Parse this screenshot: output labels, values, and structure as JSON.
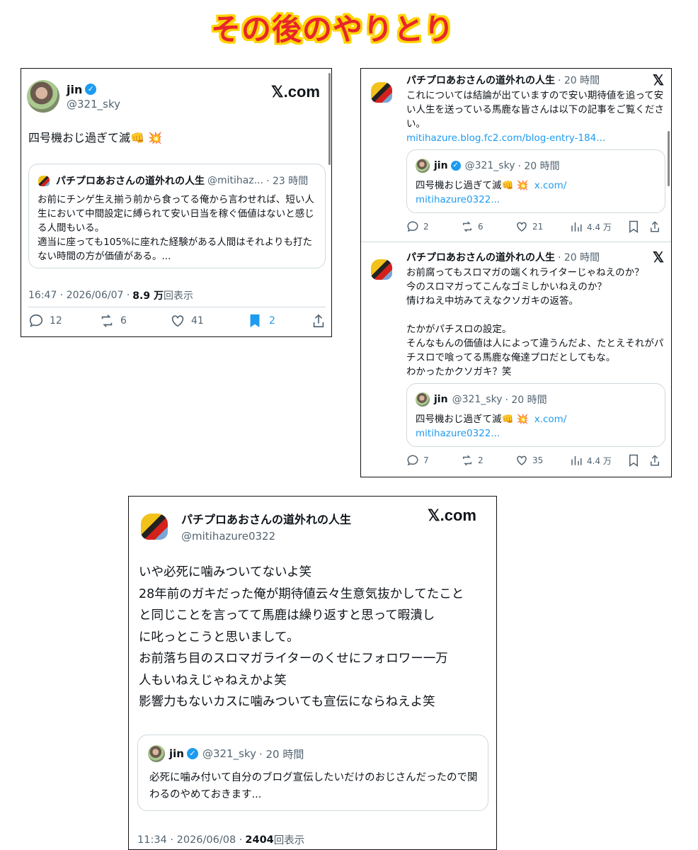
{
  "banner": {
    "title": "その後のやりとり"
  },
  "tweet1": {
    "name": "jin",
    "handle": "@321_sky",
    "brand": "𝕏.com",
    "text": "四号機おじ過ぎて滅👊 💥",
    "quote": {
      "name": "パチプロあおさんの道外れの人生",
      "handle": "@mitihaz...",
      "time": "· 23 時間",
      "text1": "お前にチンゲ生え揃う前から食ってる俺から言わせれば、短い人生において中間設定に縛られて安い日当を稼ぐ価値はないと感じる人間もいる。",
      "text2": "適当に座っても105%に座れた経験がある人間はそれよりも打たない時間の方が価値がある。..."
    },
    "meta": {
      "time": "16:47 · 2026/06/07 ·",
      "views": "8.9 万",
      "views_label": "回表示"
    },
    "actions": {
      "replies": "12",
      "retweets": "6",
      "likes": "41",
      "bookmarks": "2"
    }
  },
  "thread": {
    "reply1": {
      "name": "パチプロあおさんの道外れの人生",
      "time": "· 20 時間",
      "text": "これについては結論が出ていますので安い期待値を追って安い人生を送っている馬鹿な皆さんは以下の記事をご覧ください。",
      "link": "mitihazure.blog.fc2.com/blog-entry-184...",
      "quote": {
        "name": "jin",
        "handle": "@321_sky",
        "time": "· 20 時間",
        "text": "四号機おじ過ぎて滅👊 💥",
        "link1": "x.com/",
        "link2": "mitihazure0322..."
      },
      "actions": {
        "replies": "2",
        "retweets": "6",
        "likes": "21",
        "views": "4.4 万"
      }
    },
    "reply2": {
      "name": "パチプロあおさんの道外れの人生",
      "time": "· 20 時間",
      "lines": [
        "お前腐ってもスロマガの端くれライターじゃねえのか？",
        "今のスロマガってこんなゴミしかいねえのか？",
        "情けねえ中坊みてえなクソガキの返答。",
        "",
        "たかがパチスロの設定。",
        "そんなもんの価値は人によって違うんだよ、たとえそれがパチスロで喰ってる馬鹿な俺達プロだとしてもな。",
        "わかったかクソガキ？笑"
      ],
      "quote": {
        "name": "jin",
        "handle": "@321_sky",
        "time": "· 20 時間",
        "text": "四号機おじ過ぎて滅👊 💥",
        "link1": "x.com/",
        "link2": "mitihazure0322..."
      },
      "actions": {
        "replies": "7",
        "retweets": "2",
        "likes": "35",
        "views": "4.4 万"
      }
    }
  },
  "tweet3": {
    "name": "パチプロあおさんの道外れの人生",
    "handle": "@mitihazure0322",
    "brand": "𝕏.com",
    "lines": [
      "いや必死に噛みついてないよ笑",
      "28年前のガキだった俺が期待値云々生意気抜かしてたこと",
      "と同じことを言ってて馬鹿は繰り返すと思って暇潰し",
      "に叱っとこうと思いまして。",
      "お前落ち目のスロマガライターのくせにフォロワー一万",
      "人もいねえじゃねえかよ笑",
      "影響力もないカスに噛みついても宣伝にならねえよ笑"
    ],
    "quote": {
      "name": "jin",
      "handle": "@321_sky",
      "time": "· 20 時間",
      "text": "必死に噛み付いて自分のブログ宣伝したいだけのおじさんだったので関わるのやめておきます..."
    },
    "meta": {
      "time": "11:34 · 2026/06/08 ·",
      "views": "2404",
      "views_label": "回表示"
    }
  },
  "colors": {
    "accent": "#1d9bf0",
    "muted": "#536471",
    "banner_red": "#e8262b",
    "banner_yellow": "#ffd400"
  }
}
